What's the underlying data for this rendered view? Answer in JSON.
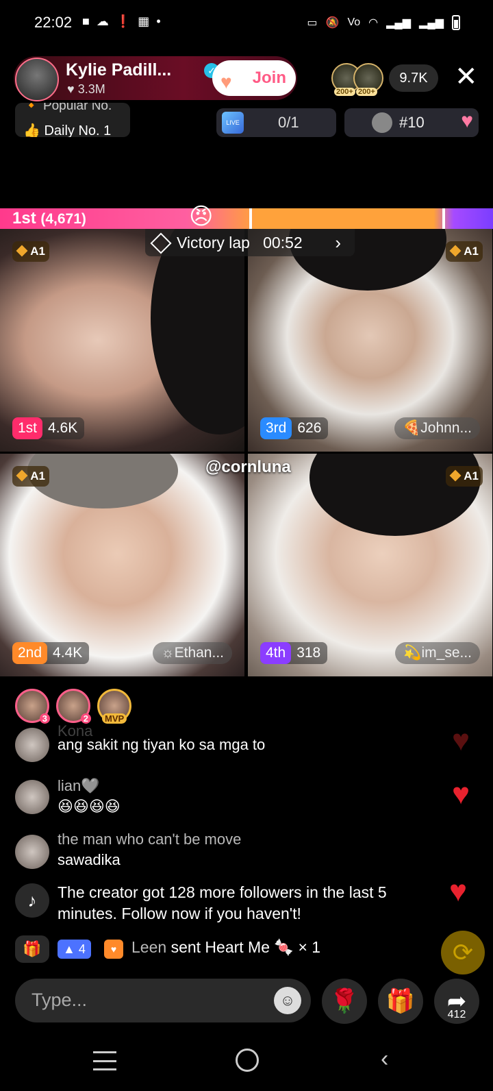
{
  "status_bar": {
    "time": "22:02",
    "left_icons": [
      "video-icon",
      "cloud-icon",
      "alert-icon",
      "book-icon",
      "dot-icon"
    ],
    "right_icons": [
      "cast-icon",
      "mute-icon",
      "volte-icon",
      "wifi-icon",
      "signal-icon",
      "signal-icon",
      "battery-icon"
    ]
  },
  "host": {
    "name": "Kylie Padill...",
    "likes": "3.3M",
    "join_label": "Join"
  },
  "viewers": {
    "badges": [
      "200+",
      "200+"
    ],
    "count": "9.7K"
  },
  "badges": {
    "popular": "Popular No.",
    "daily": "Daily No. 1",
    "score": "0/1",
    "rank": "#10"
  },
  "battle": {
    "leader_rank": "1st",
    "leader_score": "(4,671)",
    "victory_label": "Victory lap",
    "victory_time": "00:52"
  },
  "tiles": [
    {
      "level": "A1",
      "rank": "1st",
      "score": "4.6K",
      "guest": ""
    },
    {
      "level": "A1",
      "rank": "3rd",
      "score": "626",
      "guest": "🍕Johnn..."
    },
    {
      "level": "A1",
      "rank": "2nd",
      "score": "4.4K",
      "guest": "☼Ethan..."
    },
    {
      "level": "A1",
      "rank": "4th",
      "score": "318",
      "guest": "💫im_se..."
    }
  ],
  "handle": "@cornluna",
  "contributors": [
    {
      "badge": "3"
    },
    {
      "badge": "2"
    },
    {
      "badge": "MVP"
    }
  ],
  "comments": [
    {
      "user": "Kona",
      "text": "ang sakit ng tiyan ko sa mga to"
    },
    {
      "user": "lian🩶",
      "text": "😆😆😆😆"
    },
    {
      "user": "the man who can't be move",
      "text": "sawadika"
    }
  ],
  "system_message": "The creator got 128 more followers in the last 5 minutes. Follow now if you haven't!",
  "gift": {
    "level": "4",
    "user": "Leen",
    "text": "sent Heart Me",
    "count": "× 1"
  },
  "input": {
    "placeholder": "Type..."
  },
  "share_count": "412",
  "colors": {
    "accent": "#ff2c6b",
    "battle_orange": "#ffa23b",
    "battle_purple": "#7b3dff"
  }
}
